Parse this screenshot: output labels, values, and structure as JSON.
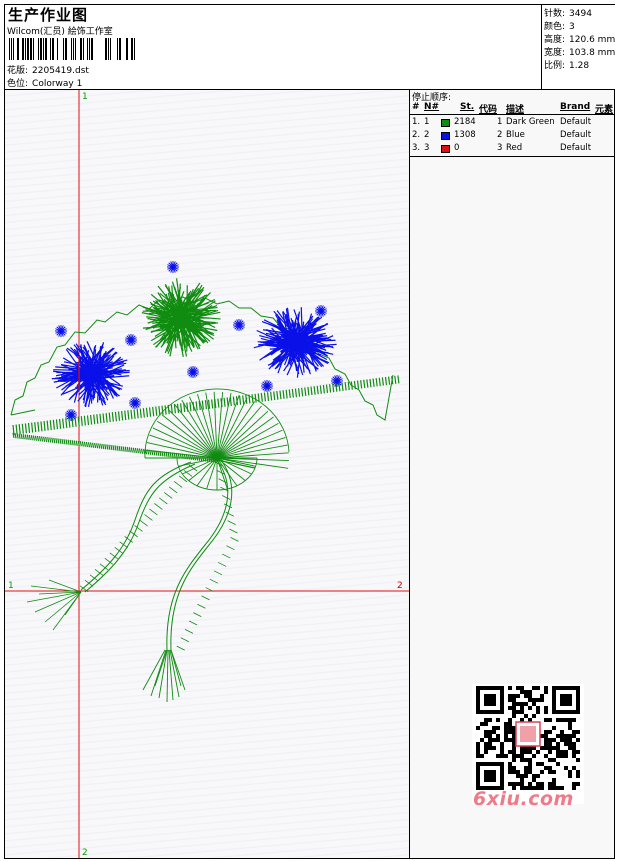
{
  "header": {
    "title": "生产作业图",
    "studio": "Wilcom(汇员) 絵饰工作室",
    "design_label": "花版:",
    "design_file": "2205419.dst",
    "colorway_label": "色位:",
    "colorway": "Colorway 1"
  },
  "stats": [
    {
      "label": "针数:",
      "value": "3494"
    },
    {
      "label": "颜色:",
      "value": "3"
    },
    {
      "label": "高度:",
      "value": "120.6 mm"
    },
    {
      "label": "宽度:",
      "value": "103.8 mm"
    },
    {
      "label": "比例:",
      "value": "1.28"
    }
  ],
  "stop_sequence": {
    "title": "停止顺序:",
    "headers": {
      "num": "#",
      "n": "N#",
      "st": "St.",
      "code": "代码",
      "desc": "描述",
      "brand": "Brand",
      "elem": "元素"
    },
    "rows": [
      {
        "num": "1.",
        "n": "1",
        "color": "#108c10",
        "st": "2184",
        "code": "1",
        "desc": "Dark Green",
        "brand": "Default"
      },
      {
        "num": "2.",
        "n": "2",
        "color": "#0a10e8",
        "st": "1308",
        "code": "2",
        "desc": "Blue",
        "brand": "Default"
      },
      {
        "num": "3.",
        "n": "3",
        "color": "#e01010",
        "st": "0",
        "code": "3",
        "desc": "Red",
        "brand": "Default"
      }
    ]
  },
  "axes": {
    "top": "1",
    "bottom": "2",
    "left": "1",
    "right": "2"
  },
  "watermark": "6xiu.com",
  "colors": {
    "green": "#108c10",
    "blue": "#0a10e8",
    "red": "#e01010"
  }
}
